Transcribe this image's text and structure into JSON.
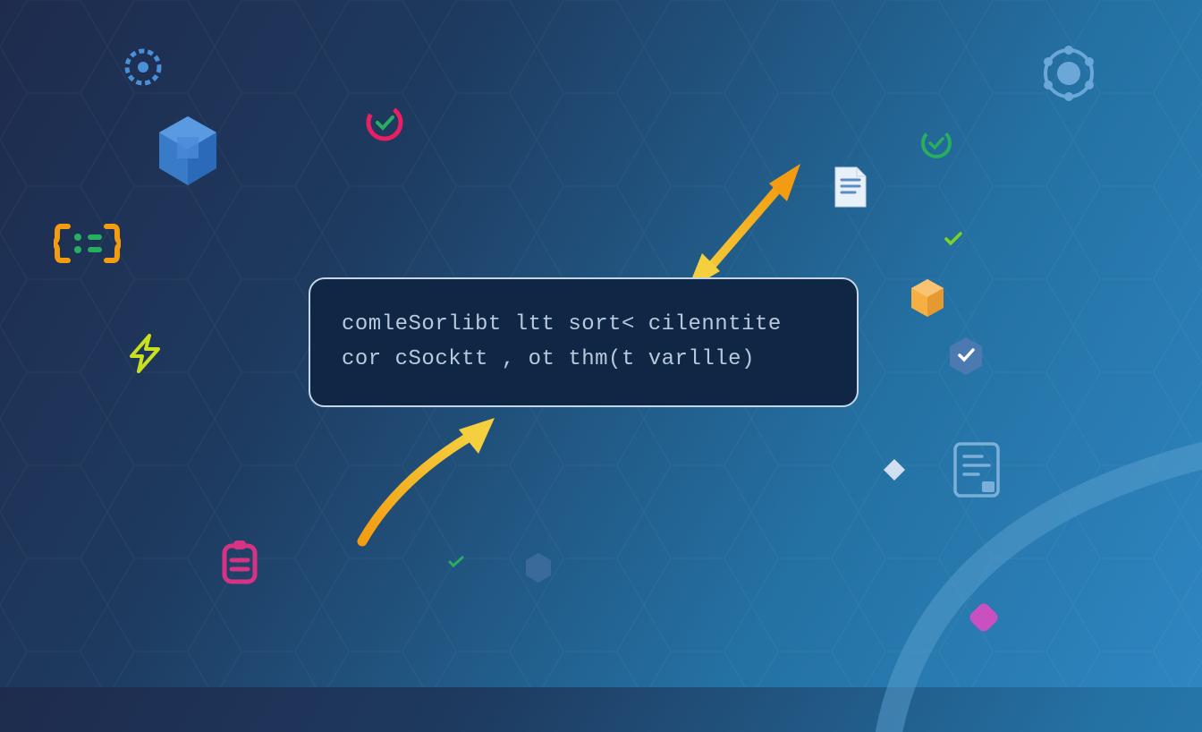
{
  "code": {
    "line1": "comleSorlibt ltt sort< cilenntite",
    "line2": "cor cSocktt , ot thm(t varllle)"
  },
  "colors": {
    "background_start": "#1e2b4d",
    "background_end": "#2e86c1",
    "code_box_bg": "#0f2744",
    "code_box_border": "#c5d5e8",
    "code_text": "#b8c9de",
    "orange": "#f39c12",
    "yellow": "#f1c40f",
    "pink": "#e91e63",
    "green": "#27ae60",
    "light_green": "#7ed321",
    "blue": "#3498db",
    "light_blue": "#5dade2",
    "magenta": "#d63384"
  },
  "icons": {
    "gear": "gear-icon",
    "hexagon_cube": "hexagon-cube-icon",
    "check_circle": "check-circle-icon",
    "code_bracket": "code-bracket-icon",
    "lightning": "lightning-icon",
    "clipboard": "clipboard-icon",
    "document": "document-icon",
    "check": "check-icon",
    "cube": "cube-icon",
    "shield": "shield-icon",
    "diamond": "diamond-icon",
    "arrow": "arrow-icon"
  }
}
